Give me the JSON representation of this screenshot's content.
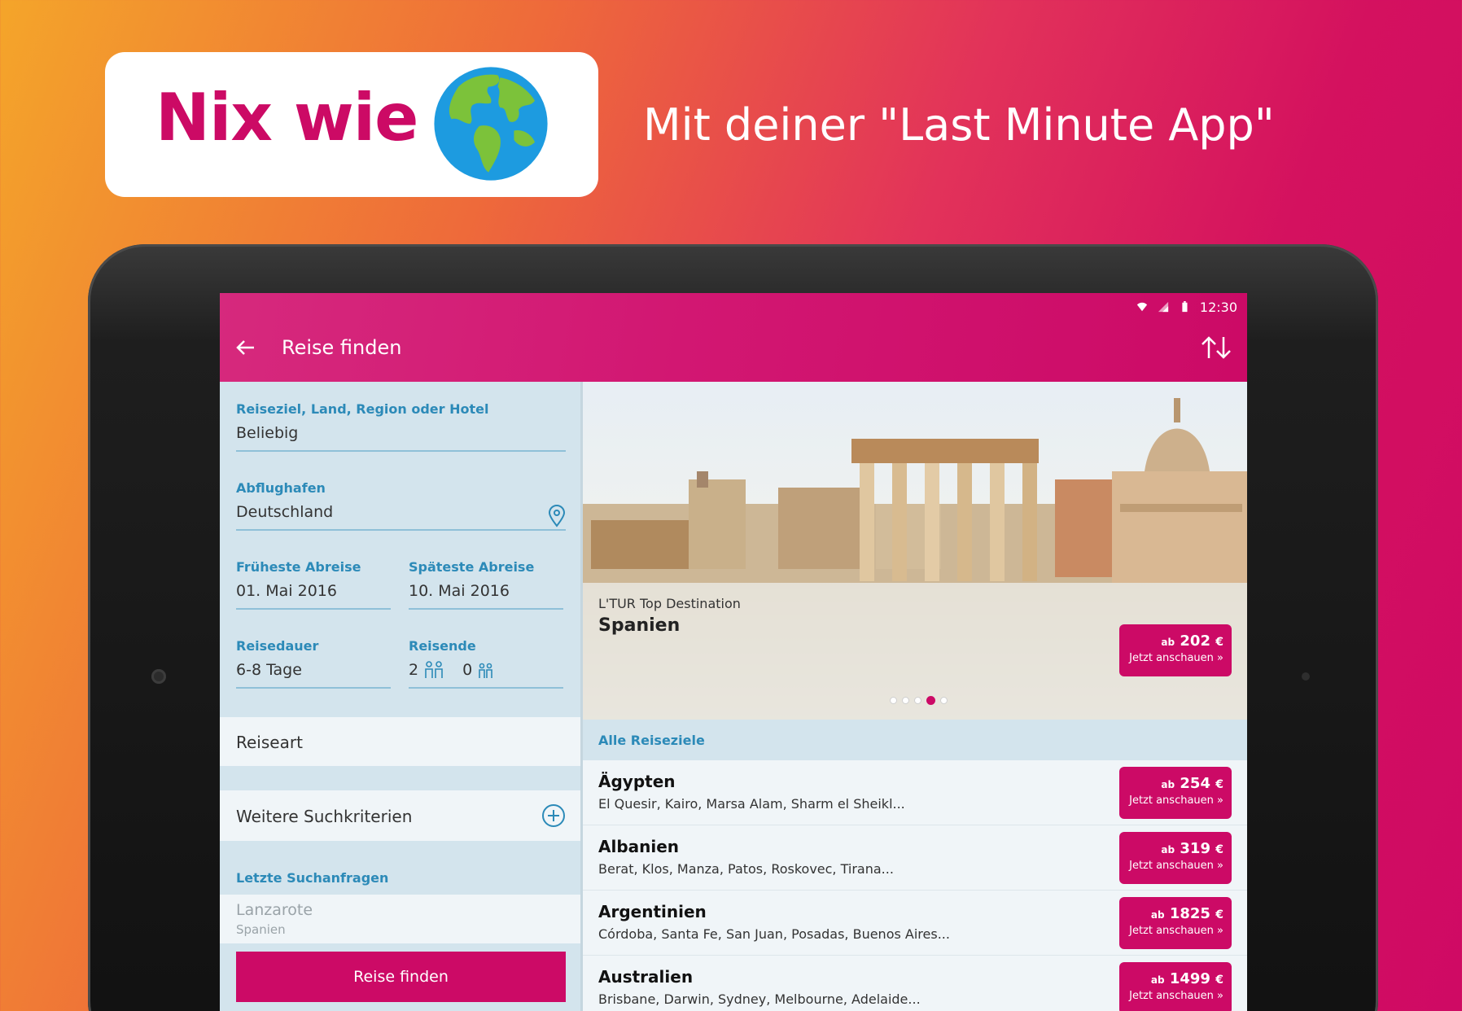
{
  "promo": {
    "title": "Nix wie",
    "tagline": "Mit deiner \"Last Minute App\""
  },
  "statusbar": {
    "time": "12:30"
  },
  "appbar": {
    "title": "Reise finden"
  },
  "form": {
    "destination": {
      "label": "Reiseziel, Land, Region oder Hotel",
      "value": "Beliebig"
    },
    "airport": {
      "label": "Abflughafen",
      "value": "Deutschland"
    },
    "earliest": {
      "label": "Früheste Abreise",
      "value": "01. Mai 2016"
    },
    "latest": {
      "label": "Späteste Abreise",
      "value": "10. Mai 2016"
    },
    "duration": {
      "label": "Reisedauer",
      "value": "6-8 Tage"
    },
    "travellers": {
      "label": "Reisende",
      "adults": "2",
      "children": "0"
    },
    "reiseart": "Reiseart",
    "weitere": "Weitere Suchkriterien",
    "recent_label": "Letzte Suchanfragen",
    "recent": {
      "title": "Lanzarote",
      "subtitle": "Spanien"
    },
    "submit": "Reise finden"
  },
  "hero": {
    "kicker": "L'TUR Top Destination",
    "title": "Spanien",
    "price_prefix": "ab",
    "price": "202",
    "currency": "€",
    "cta": "Jetzt anschauen »",
    "active_slide": 4,
    "slide_count": 5
  },
  "list": {
    "header": "Alle Reiseziele",
    "items": [
      {
        "name": "Ägypten",
        "cities": "El Quesir, Kairo, Marsa Alam, Sharm el Sheikl...",
        "prefix": "ab",
        "price": "254",
        "currency": "€",
        "cta": "Jetzt anschauen »"
      },
      {
        "name": "Albanien",
        "cities": "Berat, Klos, Manza, Patos, Roskovec, Tirana...",
        "prefix": "ab",
        "price": "319",
        "currency": "€",
        "cta": "Jetzt anschauen »"
      },
      {
        "name": "Argentinien",
        "cities": "Córdoba, Santa Fe, San Juan, Posadas, Buenos Aires...",
        "prefix": "ab",
        "price": "1825",
        "currency": "€",
        "cta": "Jetzt anschauen »"
      },
      {
        "name": "Australien",
        "cities": "Brisbane, Darwin, Sydney, Melbourne, Adelaide...",
        "prefix": "ab",
        "price": "1499",
        "currency": "€",
        "cta": "Jetzt anschauen »"
      }
    ]
  },
  "colors": {
    "brand": "#cc0a66",
    "label_blue": "#2c8ab8",
    "panel": "#d3e4ed"
  }
}
